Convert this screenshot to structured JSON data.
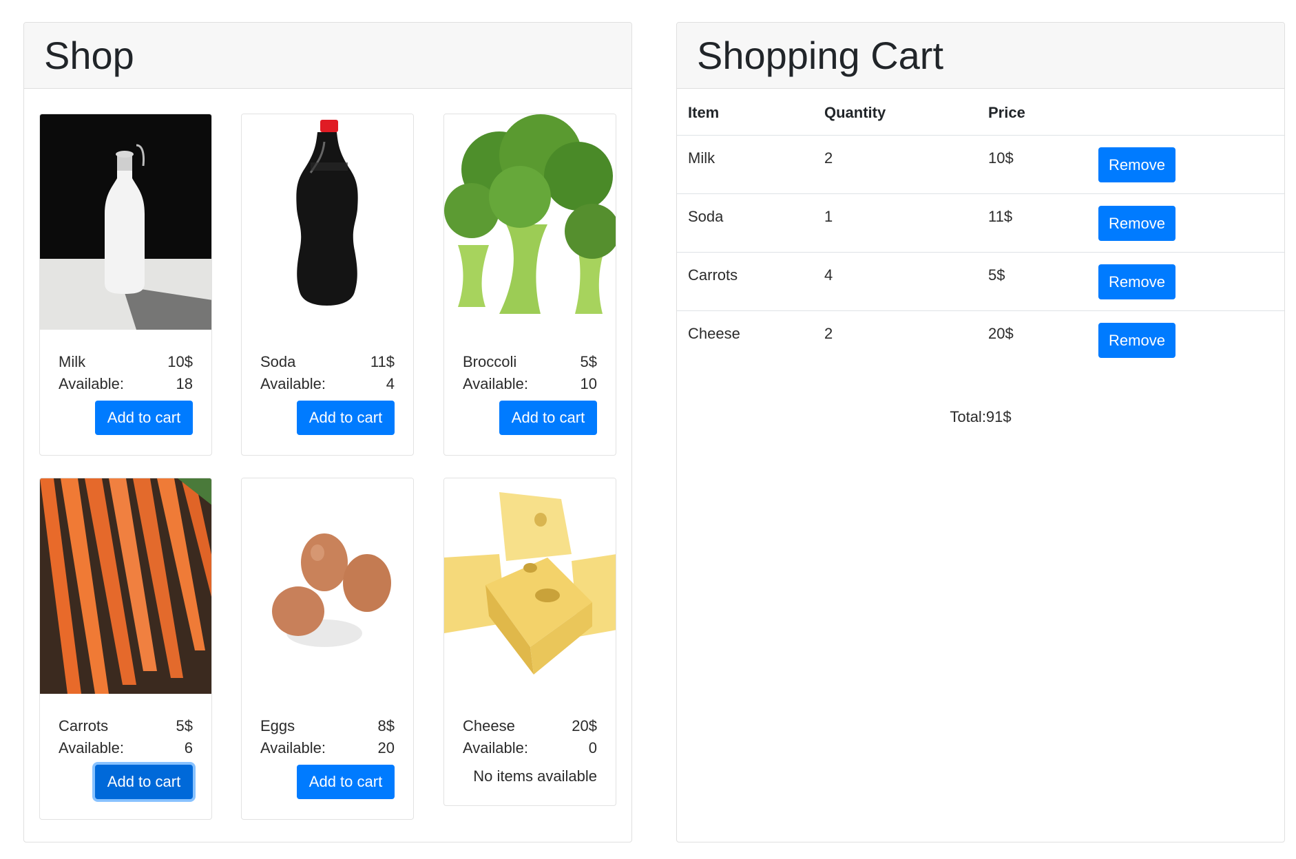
{
  "shop": {
    "title": "Shop",
    "available_label": "Available:",
    "add_label": "Add to cart",
    "no_items_label": "No items available",
    "products": [
      {
        "name": "Milk",
        "price": "10$",
        "available": "18",
        "image": "milk-bottle"
      },
      {
        "name": "Soda",
        "price": "11$",
        "available": "4",
        "image": "soda-bottle"
      },
      {
        "name": "Broccoli",
        "price": "5$",
        "available": "10",
        "image": "broccoli"
      },
      {
        "name": "Carrots",
        "price": "5$",
        "available": "6",
        "image": "carrots"
      },
      {
        "name": "Eggs",
        "price": "8$",
        "available": "20",
        "image": "eggs"
      },
      {
        "name": "Cheese",
        "price": "20$",
        "available": "0",
        "image": "cheese"
      }
    ]
  },
  "cart": {
    "title": "Shopping Cart",
    "headers": {
      "item": "Item",
      "quantity": "Quantity",
      "price": "Price"
    },
    "remove_label": "Remove",
    "rows": [
      {
        "item": "Milk",
        "quantity": "2",
        "price": "10$"
      },
      {
        "item": "Soda",
        "quantity": "1",
        "price": "11$"
      },
      {
        "item": "Carrots",
        "quantity": "4",
        "price": "5$"
      },
      {
        "item": "Cheese",
        "quantity": "2",
        "price": "20$"
      }
    ],
    "total": "Total:91$"
  },
  "colors": {
    "primary": "#007bff",
    "header_bg": "#f7f7f7",
    "border": "#dfdfdf"
  }
}
